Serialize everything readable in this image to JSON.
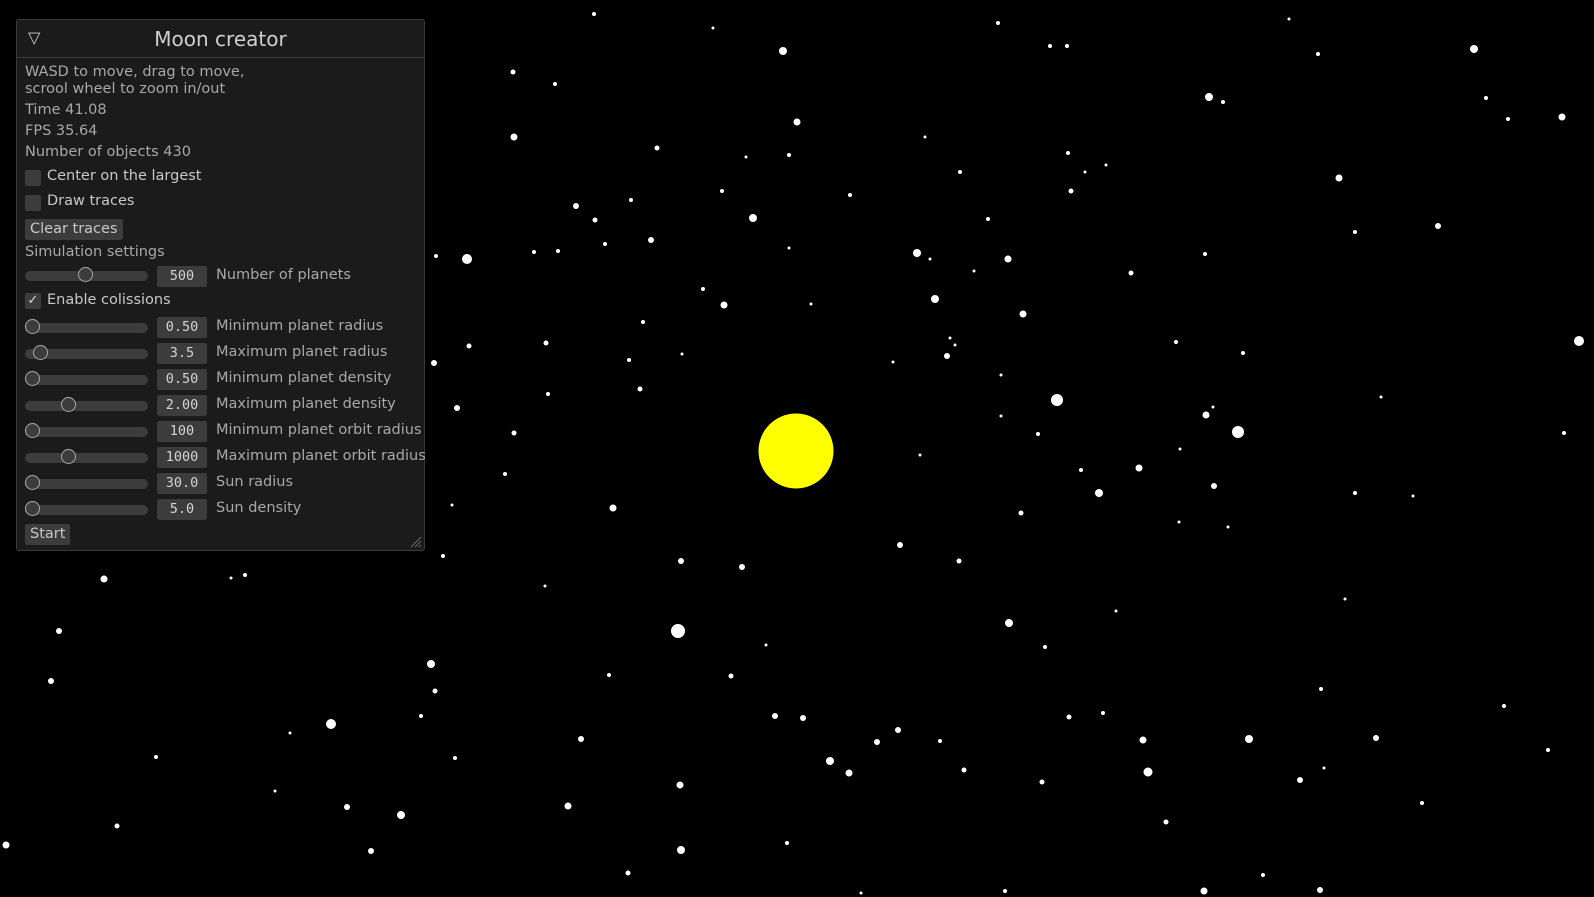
{
  "panel": {
    "title": "Moon creator",
    "collapse_icon": "triangle-down-icon",
    "help_line1": "WASD to move, drag to move,",
    "help_line2": "scrool wheel to zoom in/out",
    "time": "Time 41.08",
    "fps": "FPS 35.64",
    "objects": "Number of objects 430",
    "center_largest": {
      "label": "Center on the largest",
      "checked": false
    },
    "draw_traces": {
      "label": "Draw traces",
      "checked": false
    },
    "clear_traces_label": "Clear traces",
    "sim_settings_heading": "Simulation settings",
    "num_planets": {
      "value": "500",
      "label": "Number of planets",
      "fraction": 0.49
    },
    "enable_collisions": {
      "label": "Enable colissions",
      "checked": true
    },
    "sliders": [
      {
        "value": "0.50",
        "label": "Minimum planet radius",
        "fraction": 0.0
      },
      {
        "value": "3.5",
        "label": "Maximum planet radius",
        "fraction": 0.06
      },
      {
        "value": "0.50",
        "label": "Minimum planet density",
        "fraction": 0.0
      },
      {
        "value": "2.00",
        "label": "Maximum planet density",
        "fraction": 0.3
      },
      {
        "value": "100",
        "label": "Minimum planet orbit radius",
        "fraction": 0.0
      },
      {
        "value": "1000",
        "label": "Maximum planet orbit radius",
        "fraction": 0.3
      },
      {
        "value": "30.0",
        "label": "Sun radius",
        "fraction": 0.0
      },
      {
        "value": "5.0",
        "label": "Sun density",
        "fraction": 0.0
      }
    ],
    "start_label": "Start",
    "resize_icon": "resize-grip-icon"
  },
  "scene": {
    "background": "#000000",
    "sun_color": "#ffff00",
    "planet_color": "#ffffff"
  }
}
